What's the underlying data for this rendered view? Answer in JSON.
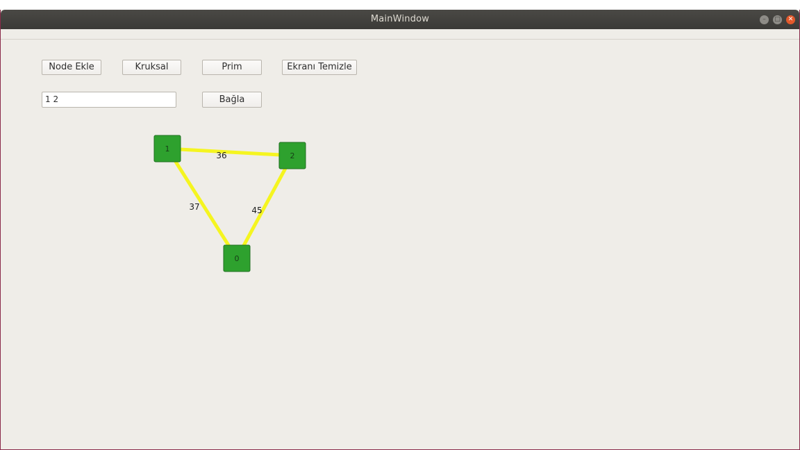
{
  "window": {
    "title": "MainWindow"
  },
  "toolbar": {
    "node_ekle": "Node Ekle",
    "kruksal": "Kruksal",
    "prim": "Prim",
    "ekrani_temizle": "Ekranı Temizle",
    "bagla": "Bağla"
  },
  "edge_input": {
    "value": "1 2"
  },
  "graph": {
    "node_color": "#2ea12e",
    "edge_color": "#f5f520",
    "nodes": [
      {
        "label": "1"
      },
      {
        "label": "2"
      },
      {
        "label": "0"
      }
    ],
    "edges": [
      {
        "from": "1",
        "to": "2",
        "weight": "36"
      },
      {
        "from": "1",
        "to": "0",
        "weight": "37"
      },
      {
        "from": "2",
        "to": "0",
        "weight": "45"
      }
    ]
  }
}
